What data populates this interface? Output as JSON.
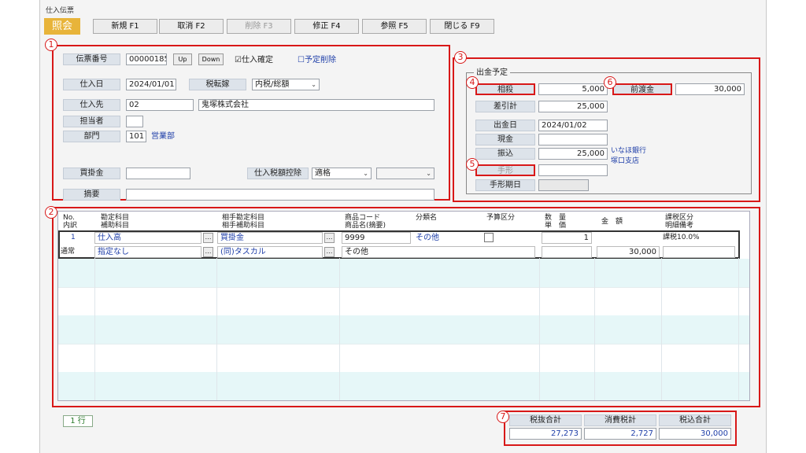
{
  "window": {
    "title": "仕入伝票",
    "mode": "照会"
  },
  "toolbar": {
    "new": "新規 F1",
    "cancel": "取消 F2",
    "delete": "削除 F3",
    "edit": "修正 F4",
    "reference": "参照 F5",
    "close": "閉じる F9"
  },
  "markers": {
    "m1": "1",
    "m2": "2",
    "m3": "3",
    "m4": "4",
    "m5": "5",
    "m6": "6",
    "m7": "7"
  },
  "header": {
    "slip_no_label": "伝票番号",
    "slip_no": "00000185",
    "up": "Up",
    "down": "Down",
    "confirmed_label": "仕入確定",
    "scheduled_delete_label": "予定削除",
    "date_label": "仕入日",
    "date": "2024/01/01",
    "tax_mode_label": "税転嫁",
    "tax_mode": "内税/総額",
    "supplier_label": "仕入先",
    "supplier_code": "02",
    "supplier_name": "鬼塚株式会社",
    "staff_label": "担当者",
    "dept_label": "部門",
    "dept_code": "101",
    "dept_name": "営業部",
    "payable_label": "買掛金",
    "tax_deduct_label": "仕入税額控除",
    "tax_deduct": "適格",
    "memo_label": "摘要"
  },
  "payment": {
    "group_label": "出金予定",
    "offset_label": "相殺",
    "offset": "5,000",
    "advance_label": "前渡金",
    "advance": "30,000",
    "balance_label": "差引計",
    "balance": "25,000",
    "date_label": "出金日",
    "date": "2024/01/02",
    "cash_label": "現金",
    "transfer_label": "振込",
    "transfer": "25,000",
    "bank_name": "いなほ銀行",
    "bank_branch": "塚口支店",
    "bill_label": "手形",
    "bill_due_label": "手形期日"
  },
  "grid": {
    "headers": {
      "no": "No.",
      "detail": "内訳",
      "account": "勘定科目",
      "sub_account": "補助科目",
      "counter_account": "相手勘定科目",
      "counter_sub": "相手補助科目",
      "item_code": "商品コード",
      "item_name": "商品名(摘要)",
      "category": "分類名",
      "budget": "予算区分",
      "qty": "数　量",
      "price": "単　価",
      "amount": "金　額",
      "tax_class": "課税区分",
      "note": "明細備考"
    },
    "row": {
      "no": "1",
      "detail": "通常",
      "account": "仕入高",
      "sub_account": "指定なし",
      "counter_account": "買掛金",
      "counter_sub": "(同)タスカル",
      "item_code": "9999",
      "item_name": "その他",
      "category": "その他",
      "qty": "1",
      "amount": "30,000",
      "tax_class": "課税10.0%"
    },
    "row_count": "1 行"
  },
  "totals": {
    "net_label": "税抜合計",
    "net": "27,273",
    "tax_label": "消費税計",
    "tax": "2,727",
    "gross_label": "税込合計",
    "gross": "30,000"
  }
}
